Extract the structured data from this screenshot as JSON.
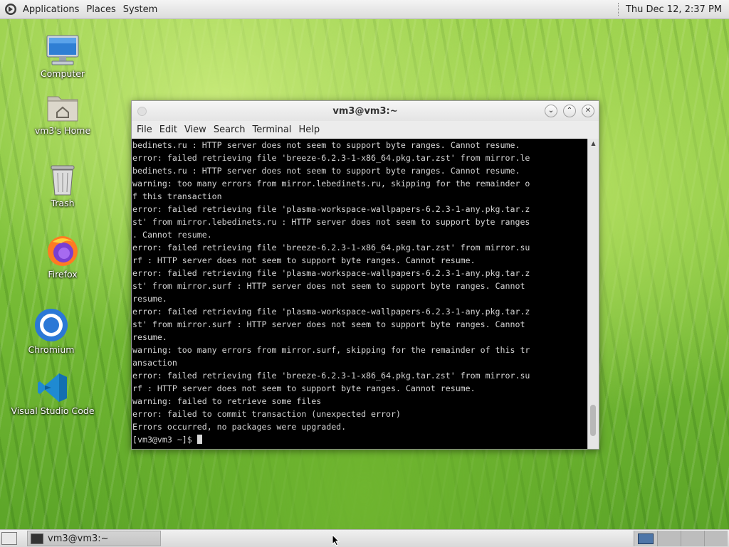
{
  "top_panel": {
    "menus": [
      "Applications",
      "Places",
      "System"
    ],
    "clock": "Thu Dec 12,  2:37 PM"
  },
  "desktop_icons": [
    {
      "label": "Computer",
      "icon": "computer-icon"
    },
    {
      "label": "vm3's Home",
      "icon": "home-folder-icon"
    },
    {
      "label": "Trash",
      "icon": "trash-icon"
    },
    {
      "label": "Firefox",
      "icon": "firefox-icon"
    },
    {
      "label": "Chromium",
      "icon": "chromium-icon"
    },
    {
      "label": "Visual Studio Code",
      "icon": "vscode-icon"
    }
  ],
  "terminal": {
    "title": "vm3@vm3:~",
    "menu": [
      "File",
      "Edit",
      "View",
      "Search",
      "Terminal",
      "Help"
    ],
    "lines": [
      "bedinets.ru : HTTP server does not seem to support byte ranges. Cannot resume.",
      "error: failed retrieving file 'breeze-6.2.3-1-x86_64.pkg.tar.zst' from mirror.le",
      "bedinets.ru : HTTP server does not seem to support byte ranges. Cannot resume.",
      "warning: too many errors from mirror.lebedinets.ru, skipping for the remainder o",
      "f this transaction",
      "error: failed retrieving file 'plasma-workspace-wallpapers-6.2.3-1-any.pkg.tar.z",
      "st' from mirror.lebedinets.ru : HTTP server does not seem to support byte ranges",
      ". Cannot resume.",
      "error: failed retrieving file 'breeze-6.2.3-1-x86_64.pkg.tar.zst' from mirror.su",
      "rf : HTTP server does not seem to support byte ranges. Cannot resume.",
      "error: failed retrieving file 'plasma-workspace-wallpapers-6.2.3-1-any.pkg.tar.z",
      "st' from mirror.surf : HTTP server does not seem to support byte ranges. Cannot",
      "resume.",
      "error: failed retrieving file 'plasma-workspace-wallpapers-6.2.3-1-any.pkg.tar.z",
      "st' from mirror.surf : HTTP server does not seem to support byte ranges. Cannot",
      "resume.",
      "warning: too many errors from mirror.surf, skipping for the remainder of this tr",
      "ansaction",
      "error: failed retrieving file 'breeze-6.2.3-1-x86_64.pkg.tar.zst' from mirror.su",
      "rf : HTTP server does not seem to support byte ranges. Cannot resume.",
      "warning: failed to retrieve some files",
      "error: failed to commit transaction (unexpected error)",
      "Errors occurred, no packages were upgraded."
    ],
    "prompt": "[vm3@vm3 ~]$ "
  },
  "bottom_panel": {
    "task_label": "vm3@vm3:~",
    "workspace_count": 4,
    "active_workspace": 1
  }
}
